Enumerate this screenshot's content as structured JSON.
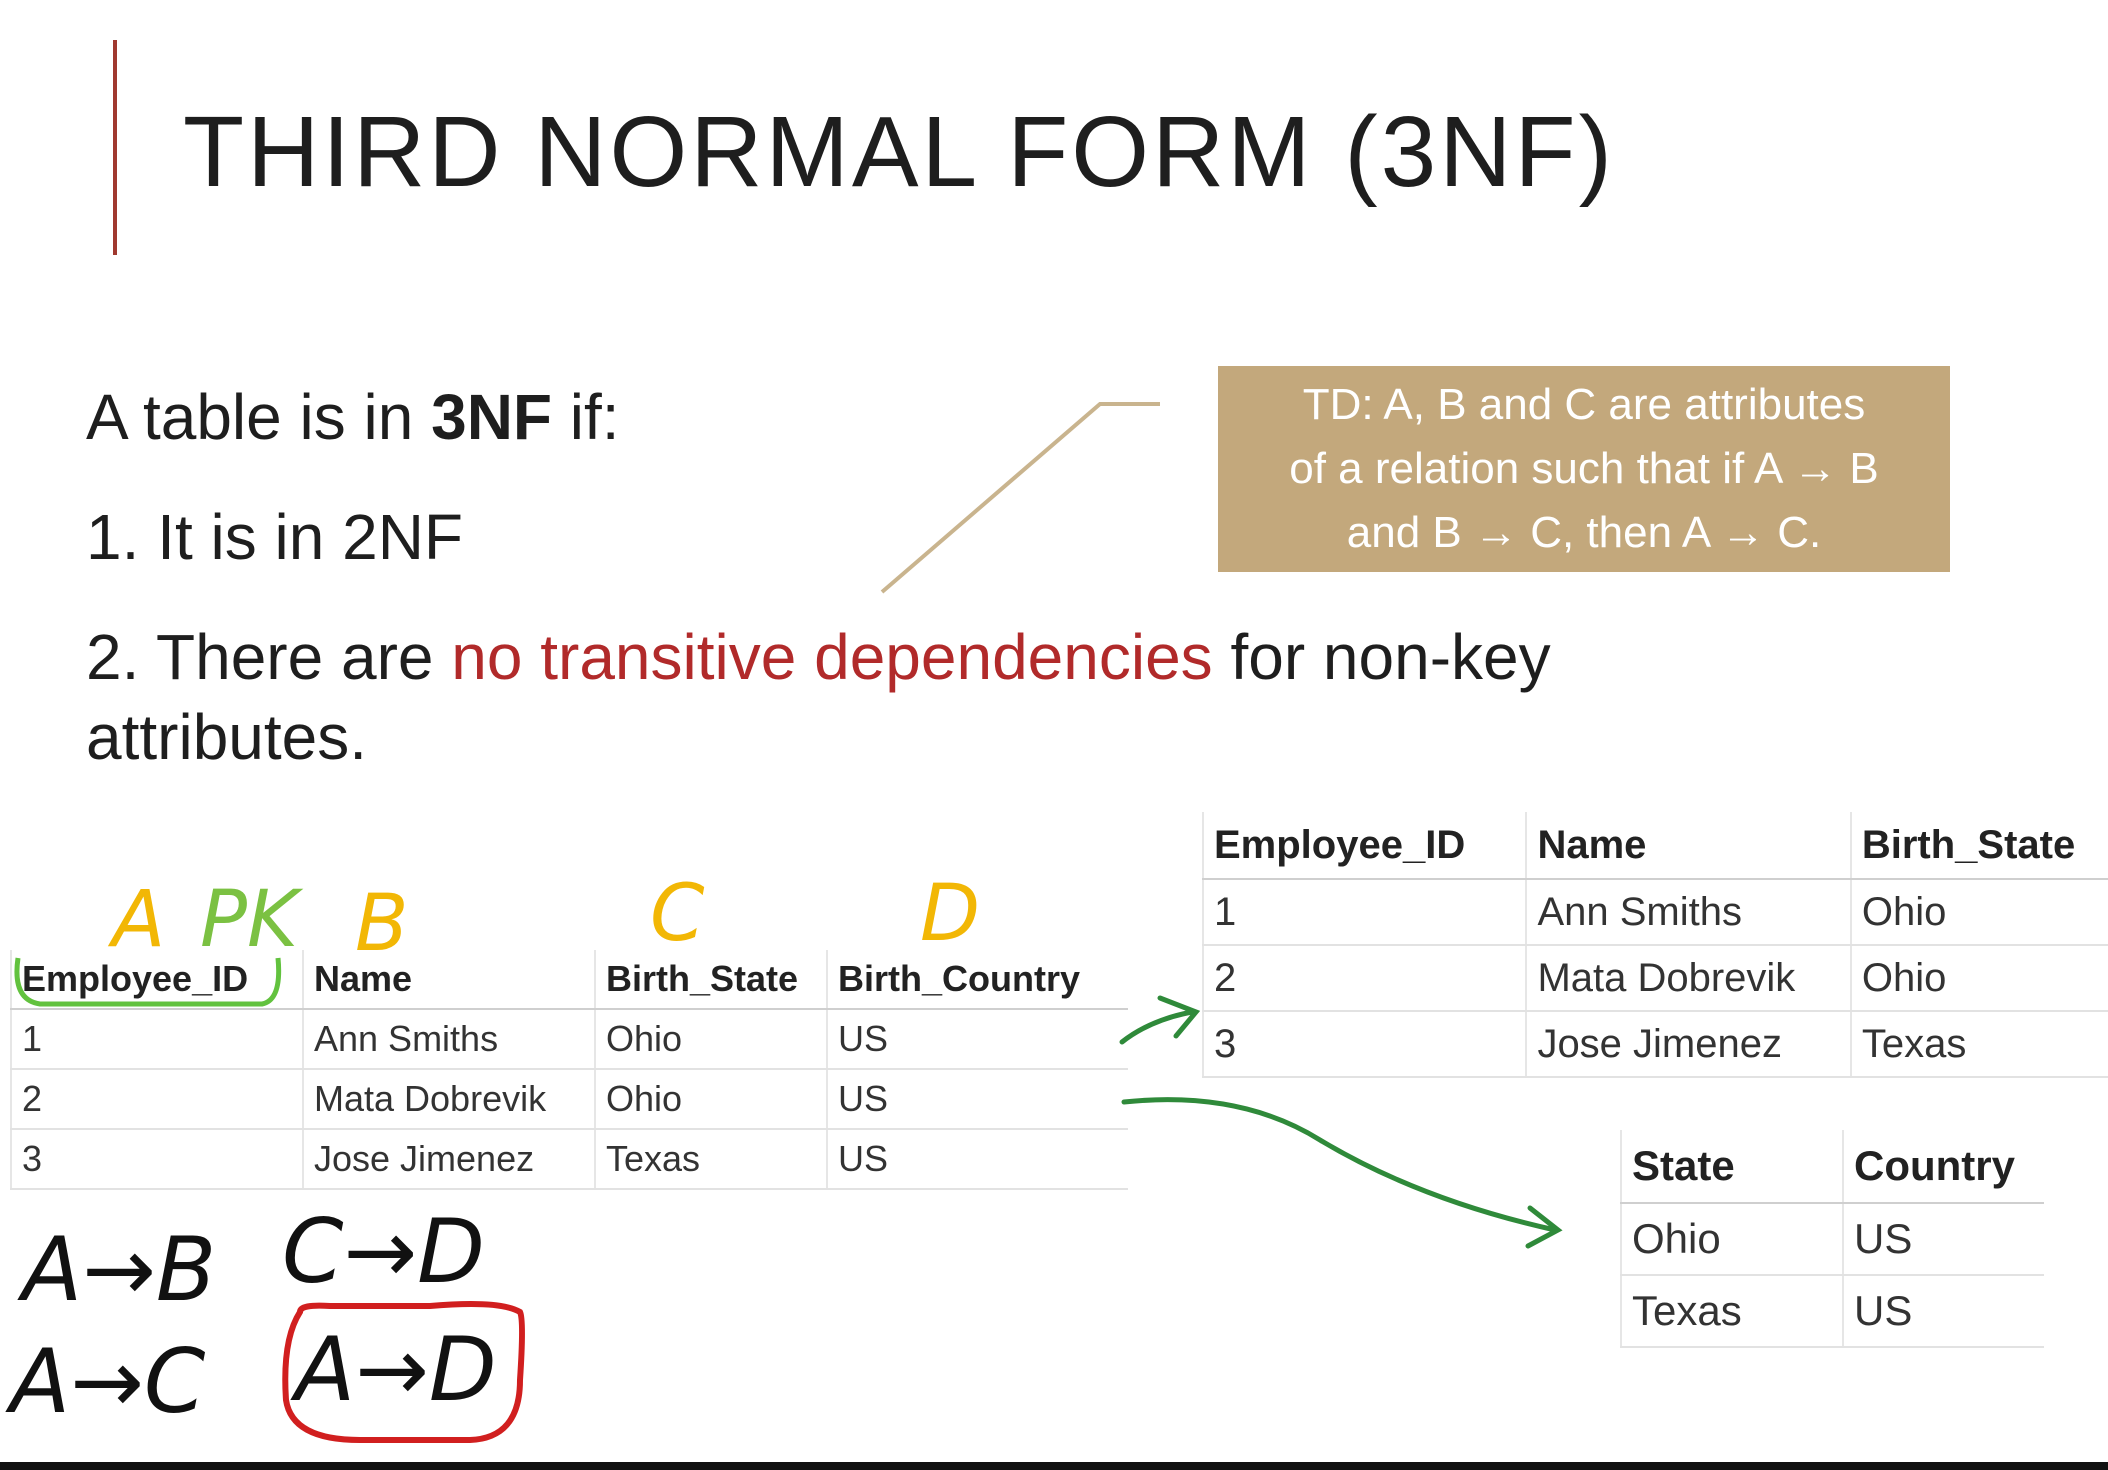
{
  "slide": {
    "title": "THIRD NORMAL FORM (3NF)",
    "intro": {
      "prefix": "A table is in ",
      "bold": "3NF",
      "suffix": " if:"
    },
    "point1": "1. It is in 2NF",
    "point2": {
      "prefix": "2. There are ",
      "highlight": "no transitive dependencies",
      "suffix": " for non-key",
      "continuation": "attributes."
    },
    "callout": {
      "lines": [
        "TD: A, B and C are attributes",
        "of a relation such that if A → B",
        "and B → C, then A → C."
      ]
    },
    "colors": {
      "accent_bar": "#a0392f",
      "highlight": "#b12a2a",
      "callout_bg": "#c3a87c",
      "ink_yellow": "#f2b705",
      "ink_green": "#2f8a3a",
      "ink_red": "#d11f1f",
      "ink_black": "#111111"
    }
  },
  "original_table": {
    "headers": [
      "Employee_ID",
      "Name",
      "Birth_State",
      "Birth_Country"
    ],
    "rows": [
      [
        "1",
        "Ann Smiths",
        "Ohio",
        "US"
      ],
      [
        "2",
        "Mata Dobrevik",
        "Ohio",
        "US"
      ],
      [
        "3",
        "Jose Jimenez",
        "Texas",
        "US"
      ]
    ]
  },
  "employee_table": {
    "headers": [
      "Employee_ID",
      "Name",
      "Birth_State"
    ],
    "rows": [
      [
        "1",
        "Ann Smiths",
        "Ohio"
      ],
      [
        "2",
        "Mata Dobrevik",
        "Ohio"
      ],
      [
        "3",
        "Jose Jimenez",
        "Texas"
      ]
    ]
  },
  "state_table": {
    "headers": [
      "State",
      "Country"
    ],
    "rows": [
      [
        "Ohio",
        "US"
      ],
      [
        "Texas",
        "US"
      ]
    ]
  },
  "annotations": {
    "col_letters": [
      "A",
      "PK",
      "B",
      "C",
      "D"
    ],
    "deps": [
      "A→B",
      "C→D",
      "A→C",
      "A→D"
    ]
  }
}
